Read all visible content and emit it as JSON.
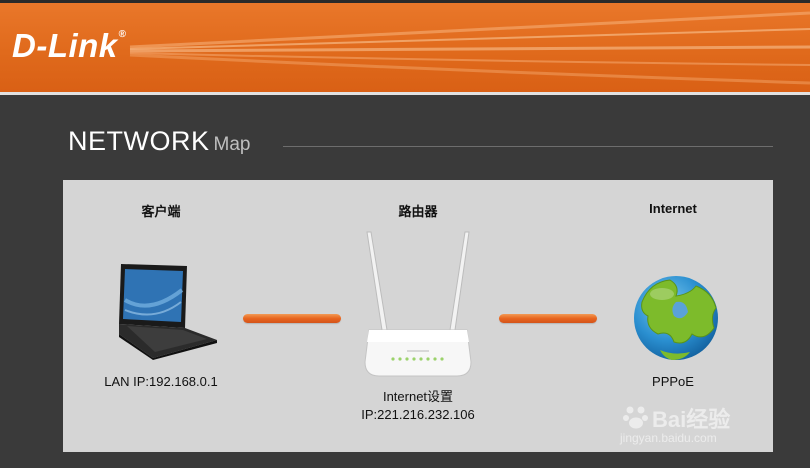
{
  "header": {
    "logo_text": "D-Link",
    "logo_mark": "®",
    "accent_color": "#e06a1c"
  },
  "section": {
    "title_main": "NETWORK",
    "title_sub": "Map"
  },
  "network_map": {
    "client": {
      "label": "客户端",
      "caption": "LAN IP:192.168.0.1",
      "icon": "laptop-icon"
    },
    "router": {
      "label": "路由器",
      "caption_line1": "Internet设置",
      "caption_line2": "IP:221.216.232.106",
      "icon": "router-icon"
    },
    "internet": {
      "label": "Internet",
      "caption": "PPPoE",
      "icon": "globe-icon"
    },
    "link_color": "#e8651e"
  },
  "watermark": {
    "brand": "Bai经验",
    "url": "jingyan.baidu.com"
  }
}
